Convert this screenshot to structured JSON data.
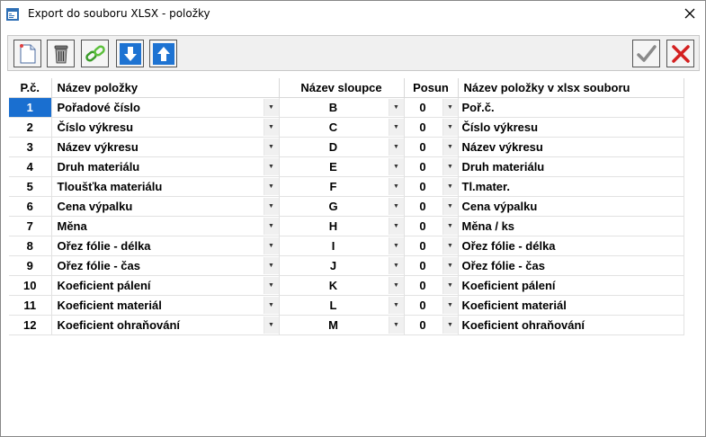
{
  "window": {
    "title": "Export do souboru XLSX - položky"
  },
  "toolbar": {
    "new_icon": "new-document-icon",
    "delete_icon": "trash-icon",
    "link_icon": "chain-link-icon",
    "down_icon": "arrow-down-icon",
    "up_icon": "arrow-up-icon",
    "ok_icon": "checkmark-icon",
    "cancel_icon": "red-x-icon"
  },
  "table": {
    "headers": {
      "num": "P.č.",
      "name": "Název položky",
      "column": "Název sloupce",
      "offset": "Posun",
      "xlsx_name": "Název položky v xlsx souboru"
    },
    "rows": [
      {
        "num": "1",
        "name": "Pořadové číslo",
        "column": "B",
        "offset": "0",
        "xlsx_name": "Poř.č."
      },
      {
        "num": "2",
        "name": "Číslo výkresu",
        "column": "C",
        "offset": "0",
        "xlsx_name": "Číslo výkresu"
      },
      {
        "num": "3",
        "name": "Název výkresu",
        "column": "D",
        "offset": "0",
        "xlsx_name": "Název výkresu"
      },
      {
        "num": "4",
        "name": "Druh materiálu",
        "column": "E",
        "offset": "0",
        "xlsx_name": "Druh materiálu"
      },
      {
        "num": "5",
        "name": "Tloušťka materiálu",
        "column": "F",
        "offset": "0",
        "xlsx_name": "Tl.mater."
      },
      {
        "num": "6",
        "name": "Cena výpalku",
        "column": "G",
        "offset": "0",
        "xlsx_name": "Cena výpalku"
      },
      {
        "num": "7",
        "name": "Měna",
        "column": "H",
        "offset": "0",
        "xlsx_name": "Měna / ks"
      },
      {
        "num": "8",
        "name": "Ořez fólie - délka",
        "column": "I",
        "offset": "0",
        "xlsx_name": "Ořez fólie - délka"
      },
      {
        "num": "9",
        "name": "Ořez fólie - čas",
        "column": "J",
        "offset": "0",
        "xlsx_name": "Ořez fólie - čas"
      },
      {
        "num": "10",
        "name": "Koeficient pálení",
        "column": "K",
        "offset": "0",
        "xlsx_name": "Koeficient pálení"
      },
      {
        "num": "11",
        "name": "Koeficient materiál",
        "column": "L",
        "offset": "0",
        "xlsx_name": "Koeficient materiál"
      },
      {
        "num": "12",
        "name": "Koeficient ohraňování",
        "column": "M",
        "offset": "0",
        "xlsx_name": "Koeficient ohraňování"
      }
    ],
    "selected_row": "1"
  },
  "colors": {
    "selection": "#1a6fd0",
    "down_arrow": "#1e73d2",
    "cancel": "#d42020"
  }
}
